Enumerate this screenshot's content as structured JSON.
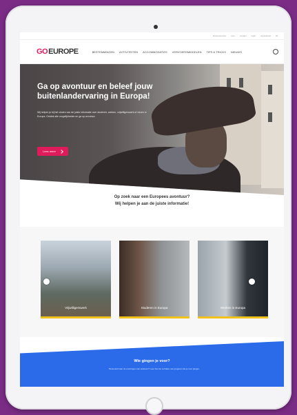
{
  "topbar": {
    "links": [
      "klantenservice",
      "over",
      "contact",
      "login",
      "nieuwsbrief",
      "NL"
    ]
  },
  "logo": {
    "go": "GO",
    "europe": "EUROPE"
  },
  "nav": {
    "items": [
      "Bestemmingen",
      "Activiteiten",
      "Accommodaties",
      "Vervoersmiddelen",
      "Tips & Tricks",
      "Nieuws"
    ]
  },
  "hero": {
    "title": "Ga op avontuur en beleef jouw buitenlandervaring in Europa!",
    "text": "Wij helpen je bij het vinden van de juiste informatie over studeren, werken, vrijwilligerswerk of reizen in Europa. Ontdek alle mogelijkheden en ga op avontuur.",
    "button_label": "Lees meer"
  },
  "intro": {
    "line1": "Op zoek naar een Europees avontuur?",
    "line2": "Wij helpen je aan de juiste informatie!"
  },
  "cards": [
    {
      "label": "Vrijwilligerswerk"
    },
    {
      "label": "Studeren in Europa"
    },
    {
      "label": "Werken in Europa"
    }
  ],
  "footer_band": {
    "title": "Wie gingen je voor?",
    "text": "Benieuwd naar de ervaringen van anderen? Lees hier de verhalen van jongeren die je voor gingen."
  },
  "colors": {
    "brand_pink": "#e01b5c",
    "blue": "#2b6bea",
    "yellow": "#f2c21b",
    "frame_purple": "#7b2d86"
  }
}
